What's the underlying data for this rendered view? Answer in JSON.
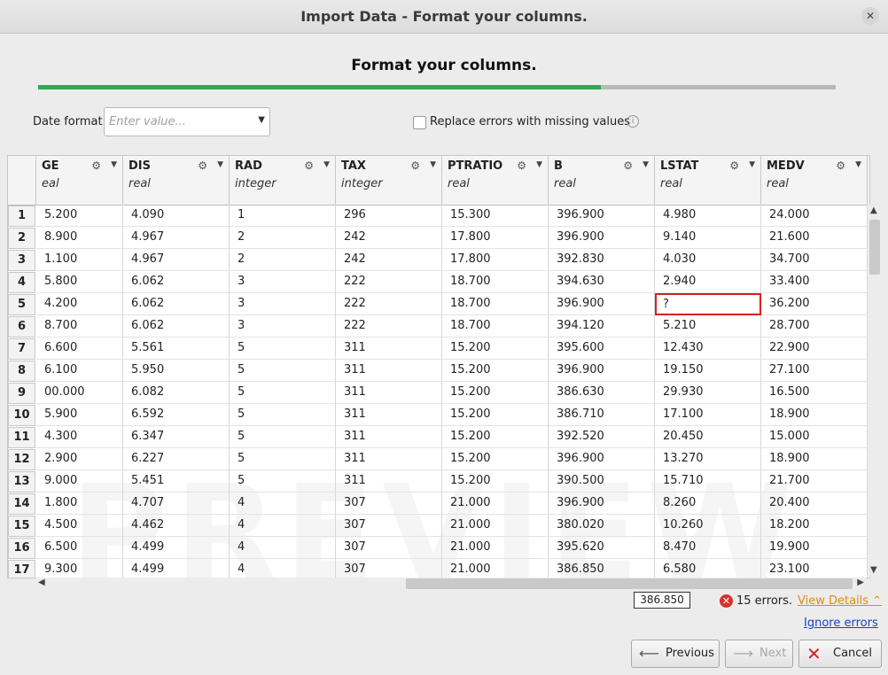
{
  "window": {
    "title": "Import Data - Format your columns."
  },
  "heading": "Format your columns.",
  "progress": {
    "fraction": 0.705
  },
  "date_format": {
    "label": "Date format",
    "placeholder": "Enter value..."
  },
  "replace_errors": {
    "label": "Replace errors with missing values",
    "checked": false
  },
  "watermark": "PREVIEW",
  "columns": [
    {
      "name": "AGE",
      "type": "real",
      "shown_name": "GE",
      "shown_type": "eal"
    },
    {
      "name": "DIS",
      "type": "real",
      "shown_name": "DIS",
      "shown_type": "real"
    },
    {
      "name": "RAD",
      "type": "integer",
      "shown_name": "RAD",
      "shown_type": "integer"
    },
    {
      "name": "TAX",
      "type": "integer",
      "shown_name": "TAX",
      "shown_type": "integer"
    },
    {
      "name": "PTRATIO",
      "type": "real",
      "shown_name": "PTRATIO",
      "shown_type": "real"
    },
    {
      "name": "B",
      "type": "real",
      "shown_name": "B",
      "shown_type": "real"
    },
    {
      "name": "LSTAT",
      "type": "real",
      "shown_name": "LSTAT",
      "shown_type": "real"
    },
    {
      "name": "MEDV",
      "type": "real",
      "shown_name": "MEDV",
      "shown_type": "real"
    }
  ],
  "rows": [
    {
      "n": "1",
      "cells": [
        "5.200",
        "4.090",
        "1",
        "296",
        "15.300",
        "396.900",
        "4.980",
        "24.000"
      ]
    },
    {
      "n": "2",
      "cells": [
        "8.900",
        "4.967",
        "2",
        "242",
        "17.800",
        "396.900",
        "9.140",
        "21.600"
      ]
    },
    {
      "n": "3",
      "cells": [
        "1.100",
        "4.967",
        "2",
        "242",
        "17.800",
        "392.830",
        "4.030",
        "34.700"
      ]
    },
    {
      "n": "4",
      "cells": [
        "5.800",
        "6.062",
        "3",
        "222",
        "18.700",
        "394.630",
        "2.940",
        "33.400"
      ]
    },
    {
      "n": "5",
      "cells": [
        "4.200",
        "6.062",
        "3",
        "222",
        "18.700",
        "396.900",
        "?",
        "36.200"
      ],
      "error_col": 6
    },
    {
      "n": "6",
      "cells": [
        "8.700",
        "6.062",
        "3",
        "222",
        "18.700",
        "394.120",
        "5.210",
        "28.700"
      ]
    },
    {
      "n": "7",
      "cells": [
        "6.600",
        "5.561",
        "5",
        "311",
        "15.200",
        "395.600",
        "12.430",
        "22.900"
      ]
    },
    {
      "n": "8",
      "cells": [
        "6.100",
        "5.950",
        "5",
        "311",
        "15.200",
        "396.900",
        "19.150",
        "27.100"
      ]
    },
    {
      "n": "9",
      "cells": [
        "00.000",
        "6.082",
        "5",
        "311",
        "15.200",
        "386.630",
        "29.930",
        "16.500"
      ]
    },
    {
      "n": "10",
      "cells": [
        "5.900",
        "6.592",
        "5",
        "311",
        "15.200",
        "386.710",
        "17.100",
        "18.900"
      ]
    },
    {
      "n": "11",
      "cells": [
        "4.300",
        "6.347",
        "5",
        "311",
        "15.200",
        "392.520",
        "20.450",
        "15.000"
      ]
    },
    {
      "n": "12",
      "cells": [
        "2.900",
        "6.227",
        "5",
        "311",
        "15.200",
        "396.900",
        "13.270",
        "18.900"
      ]
    },
    {
      "n": "13",
      "cells": [
        "9.000",
        "5.451",
        "5",
        "311",
        "15.200",
        "390.500",
        "15.710",
        "21.700"
      ]
    },
    {
      "n": "14",
      "cells": [
        "1.800",
        "4.707",
        "4",
        "307",
        "21.000",
        "396.900",
        "8.260",
        "20.400"
      ]
    },
    {
      "n": "15",
      "cells": [
        "4.500",
        "4.462",
        "4",
        "307",
        "21.000",
        "380.020",
        "10.260",
        "18.200"
      ]
    },
    {
      "n": "16",
      "cells": [
        "6.500",
        "4.499",
        "4",
        "307",
        "21.000",
        "395.620",
        "8.470",
        "19.900"
      ]
    },
    {
      "n": "17",
      "cells": [
        "9.300",
        "4.499",
        "4",
        "307",
        "21.000",
        "386.850",
        "6.580",
        "23.100"
      ]
    }
  ],
  "tooltip": "386.850",
  "errors": {
    "count_text": "15 errors.",
    "view_details": "View Details",
    "ignore": "Ignore errors"
  },
  "buttons": {
    "previous": "Previous",
    "next": "Next",
    "cancel": "Cancel"
  },
  "colors": {
    "accent": "#2fa84f",
    "error": "#d62020",
    "link": "#1a3fc7",
    "warning_link": "#e88a0c"
  }
}
